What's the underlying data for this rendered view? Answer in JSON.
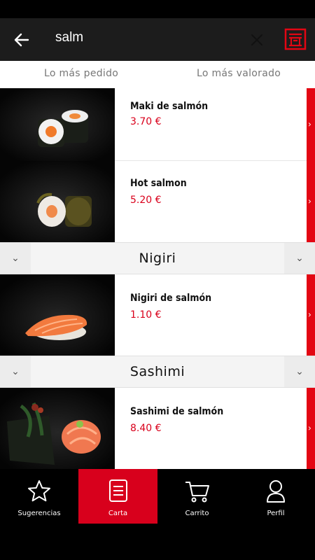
{
  "search": {
    "query": "salm"
  },
  "tabs": [
    {
      "label": "Lo más pedido"
    },
    {
      "label": "Lo más valorado"
    }
  ],
  "items": [
    {
      "name": "Maki de salmón",
      "price": "3.70 €"
    },
    {
      "name": "Hot salmon",
      "price": "5.20 €"
    },
    {
      "name": "Nigiri de salmón",
      "price": "1.10 €"
    },
    {
      "name": "Sashimi de salmón",
      "price": "8.40 €"
    }
  ],
  "categories": [
    {
      "title": "Nigiri"
    },
    {
      "title": "Sashimi"
    }
  ],
  "nav": [
    {
      "label": "Sugerencias",
      "icon": "star-icon"
    },
    {
      "label": "Carta",
      "icon": "menu-icon",
      "active": true
    },
    {
      "label": "Carrito",
      "icon": "cart-icon"
    },
    {
      "label": "Perfil",
      "icon": "profile-icon"
    }
  ],
  "colors": {
    "accent": "#e30613",
    "price": "#d9001b"
  }
}
